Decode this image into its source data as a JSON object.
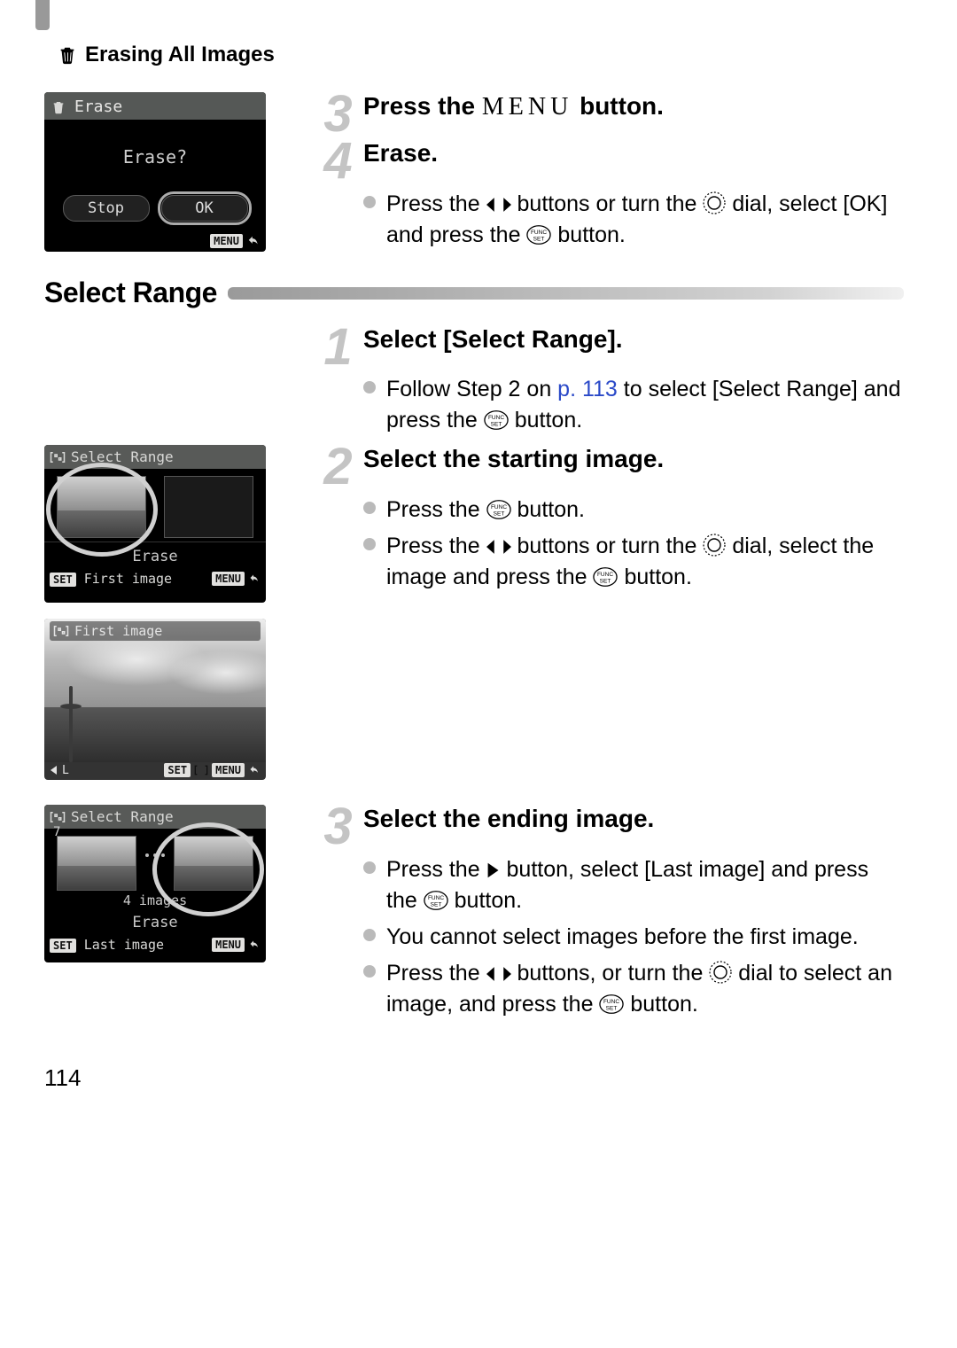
{
  "header": {
    "title": "Erasing All Images"
  },
  "section1": {
    "step3": {
      "num": "3",
      "title_pre": "Press the ",
      "title_post": " button."
    },
    "step4": {
      "num": "4",
      "title": "Erase.",
      "bullet1_a": "Press the ",
      "bullet1_b": " buttons or turn the ",
      "bullet1_c": " dial, select [OK] and press the ",
      "bullet1_d": " button."
    },
    "lcd": {
      "title": "Erase",
      "prompt": "Erase?",
      "btn_stop": "Stop",
      "btn_ok": "OK",
      "menu": "MENU"
    }
  },
  "section2": {
    "heading": "Select Range",
    "step1": {
      "num": "1",
      "title": "Select [Select Range].",
      "b1a": "Follow Step 2 on ",
      "b1link": "p. 113",
      "b1b": " to select [Select Range] and press the ",
      "b1c": " button."
    },
    "step2": {
      "num": "2",
      "title": "Select the starting image.",
      "b1a": "Press the ",
      "b1b": " button.",
      "b2a": "Press the ",
      "b2b": " buttons or turn the ",
      "b2c": " dial, select the image and press the ",
      "b2d": " button."
    },
    "step3": {
      "num": "3",
      "title": "Select the ending image.",
      "b1a": "Press the ",
      "b1b": " button, select [Last image] and press the ",
      "b1c": " button.",
      "b2": "You cannot select images before the first image.",
      "b3a": "Press the ",
      "b3b": " buttons, or turn the ",
      "b3c": " dial to select an image, and press the ",
      "b3d": " button."
    },
    "lcd_range": {
      "title": "Select Range",
      "erase": "Erase",
      "set": "SET",
      "first_image": "First image",
      "menu": "MENU"
    },
    "photo": {
      "title": "First image",
      "set": "SET",
      "menu": "MENU",
      "L": "L"
    },
    "lcd_range2": {
      "title": "Select Range",
      "count": "4 images",
      "erase": "Erase",
      "set": "SET",
      "last_image": "Last image",
      "menu": "MENU"
    }
  },
  "page": "114"
}
